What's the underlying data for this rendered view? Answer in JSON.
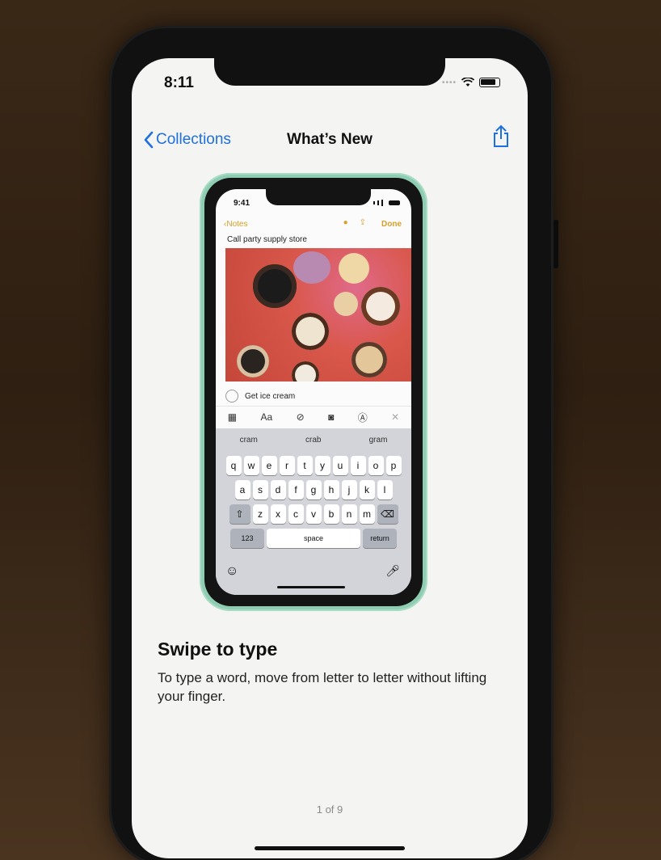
{
  "status": {
    "time": "8:11"
  },
  "nav": {
    "back_label": "Collections",
    "title": "What’s New"
  },
  "illustration": {
    "time": "9:41",
    "toolbar": {
      "back_label": "Notes",
      "done_label": "Done"
    },
    "note_text": "Call party supply store",
    "checklist_item": "Get ice cream",
    "format_text_label": "Aa",
    "suggestions": [
      "cram",
      "crab",
      "gram"
    ],
    "keys_row1": [
      "q",
      "w",
      "e",
      "r",
      "t",
      "y",
      "u",
      "i",
      "o",
      "p"
    ],
    "keys_row2": [
      "a",
      "s",
      "d",
      "f",
      "g",
      "h",
      "j",
      "k",
      "l"
    ],
    "keys_row3": [
      "z",
      "x",
      "c",
      "v",
      "b",
      "n",
      "m"
    ],
    "numbers_key": "123",
    "space_key": "space",
    "return_key": "return"
  },
  "content": {
    "heading": "Swipe to type",
    "description": "To type a word, move from letter to letter without lifting your finger.",
    "pager": "1 of 9"
  },
  "colors": {
    "accent": "#1e6fe0",
    "notes_accent": "#d7a02b"
  }
}
